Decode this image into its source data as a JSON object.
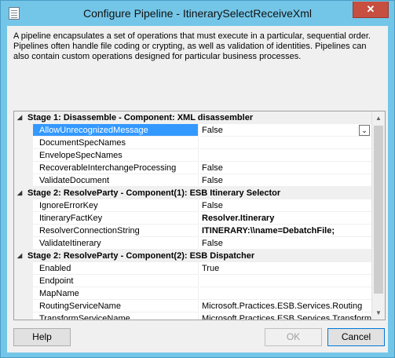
{
  "window": {
    "title": "Configure Pipeline - ItinerarySelectReceiveXml",
    "close_glyph": "✕"
  },
  "description": "A pipeline encapsulates a set of operations that must execute in a particular, sequential order. Pipelines often handle file coding or crypting, as well as validation of identities. Pipelines can also contain custom operations designed for particular business processes.",
  "grid": {
    "collapse_glyph": "◢",
    "dropdown_glyph": "⌄",
    "rows": [
      {
        "type": "category",
        "label": "Stage 1: Disassemble - Component: XML disassembler"
      },
      {
        "type": "property",
        "name": "AllowUnrecognizedMessage",
        "value": "False",
        "selected": true,
        "dropdown": true
      },
      {
        "type": "property",
        "name": "DocumentSpecNames",
        "value": ""
      },
      {
        "type": "property",
        "name": "EnvelopeSpecNames",
        "value": ""
      },
      {
        "type": "property",
        "name": "RecoverableInterchangeProcessing",
        "value": "False"
      },
      {
        "type": "property",
        "name": "ValidateDocument",
        "value": "False"
      },
      {
        "type": "category",
        "label": "Stage 2: ResolveParty - Component(1): ESB Itinerary Selector"
      },
      {
        "type": "property",
        "name": "IgnoreErrorKey",
        "value": "False"
      },
      {
        "type": "property",
        "name": "ItineraryFactKey",
        "value": "Resolver.Itinerary",
        "bold": true
      },
      {
        "type": "property",
        "name": "ResolverConnectionString",
        "value": "ITINERARY:\\\\name=DebatchFile;",
        "bold": true
      },
      {
        "type": "property",
        "name": "ValidateItinerary",
        "value": "False"
      },
      {
        "type": "category",
        "label": "Stage 2: ResolveParty - Component(2): ESB Dispatcher"
      },
      {
        "type": "property",
        "name": "Enabled",
        "value": "True"
      },
      {
        "type": "property",
        "name": "Endpoint",
        "value": ""
      },
      {
        "type": "property",
        "name": "MapName",
        "value": ""
      },
      {
        "type": "property",
        "name": "RoutingServiceName",
        "value": "Microsoft.Practices.ESB.Services.Routing"
      },
      {
        "type": "property",
        "name": "TransformServiceName",
        "value": "Microsoft.Practices.ESB.Services.Transform"
      }
    ]
  },
  "scrollbar": {
    "up_glyph": "▲",
    "down_glyph": "▼"
  },
  "buttons": {
    "help": "Help",
    "ok": "OK",
    "cancel": "Cancel"
  }
}
